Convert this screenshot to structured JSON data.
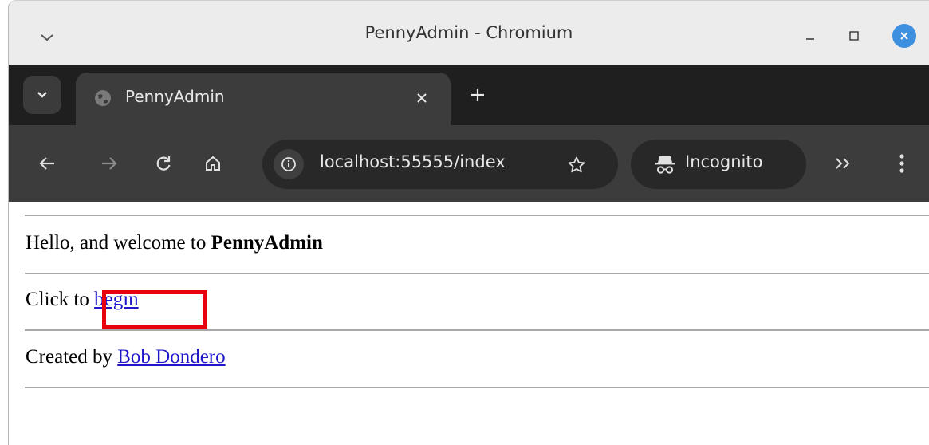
{
  "window": {
    "title": "PennyAdmin - Chromium"
  },
  "tabs": [
    {
      "label": "PennyAdmin"
    }
  ],
  "toolbar": {
    "url": "localhost:55555/index",
    "incognito_label": "Incognito"
  },
  "page": {
    "welcome_prefix": "Hello, and welcome to ",
    "welcome_bold": "PennyAdmin",
    "click_prefix": "Click to ",
    "begin_link": "begin",
    "created_prefix": "Created by ",
    "author_link": "Bob Dondero"
  },
  "annotation": {
    "highlight_color": "#e8000d"
  },
  "colors": {
    "titlebar": "#ececec",
    "tabstrip": "#1f1f1f",
    "toolbar": "#3c3c3c",
    "omnibox": "#282828",
    "link": "#1d17c9",
    "close_button": "#3d8fe0"
  }
}
